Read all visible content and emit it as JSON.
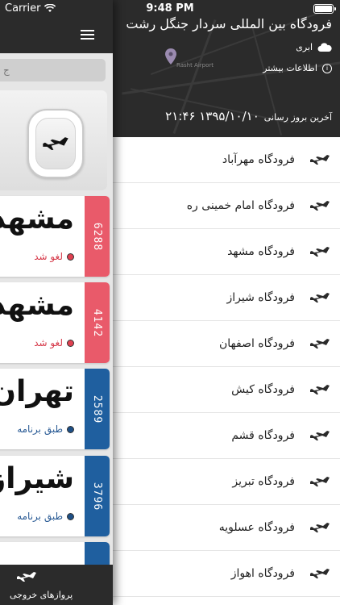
{
  "status_bar": {
    "carrier": "Carrier",
    "time": "9:48 PM"
  },
  "airport": {
    "title": "فرودگاه بین المللی سردار جنگل رشت",
    "weather": "ابری",
    "weather_icon": "cloud-icon",
    "more_info": "اطلاعات بیشتر",
    "map_label": "Rasht Airport",
    "last_update_label": "آخرین بروز رسانی",
    "last_update_value": "۱۳۹۵/۱۰/۱۰ ۲۱:۴۶"
  },
  "airports": [
    {
      "label": "فرودگاه مهرآباد"
    },
    {
      "label": "فرودگاه امام خمینی ره"
    },
    {
      "label": "فرودگاه مشهد"
    },
    {
      "label": "فرودگاه شیراز"
    },
    {
      "label": "فرودگاه اصفهان"
    },
    {
      "label": "فرودگاه کیش"
    },
    {
      "label": "فرودگاه قشم"
    },
    {
      "label": "فرودگاه تبریز"
    },
    {
      "label": "فرودگاه عسلویه"
    },
    {
      "label": "فرودگاه اهواز"
    }
  ],
  "drawer": {
    "search_placeholder": "ج",
    "flights": [
      {
        "city": "مشهد",
        "status": "لغو شد",
        "number": "6288",
        "strip_color": "#e95a6a",
        "status_color": "#d63a4a",
        "dot_color": "#e04050"
      },
      {
        "city": "مشهد",
        "status": "لغو شد",
        "number": "4142",
        "strip_color": "#e95a6a",
        "status_color": "#d63a4a",
        "dot_color": "#e04050"
      },
      {
        "city": "تهران",
        "status": "طبق برنامه",
        "number": "2589",
        "strip_color": "#1f5f9f",
        "status_color": "#2a5b95",
        "dot_color": "#1d4f86"
      },
      {
        "city": "شیراز",
        "status": "طبق برنامه",
        "number": "3796",
        "strip_color": "#1f5f9f",
        "status_color": "#2a5b95",
        "dot_color": "#1d4f86"
      },
      {
        "city": "",
        "status": "",
        "number": "",
        "strip_color": "#1f5f9f",
        "status_color": "#2a5b95",
        "dot_color": "#1d4f86"
      }
    ],
    "tab_label": "پروازهای خروجی"
  }
}
